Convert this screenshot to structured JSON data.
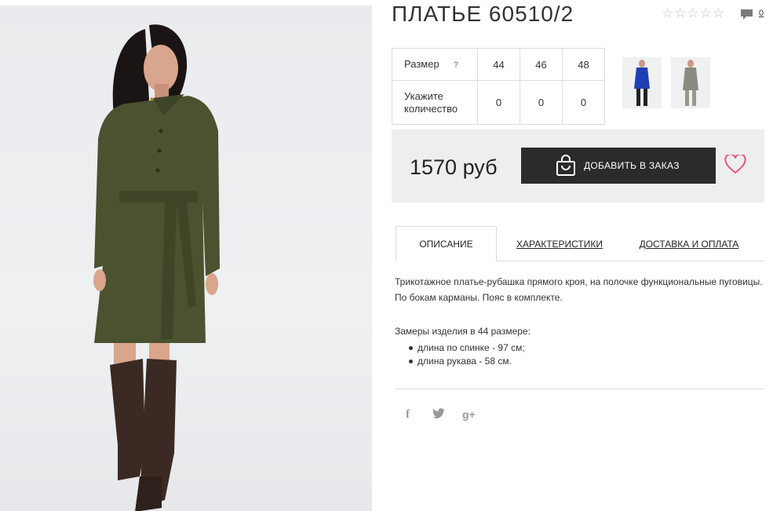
{
  "product": {
    "title": "ПЛАТЬЕ 60510/2",
    "rating_stars": 5,
    "comment_count": "0",
    "star_glyph": "☆"
  },
  "sizes": {
    "size_label": "Размер",
    "help_mark": "?",
    "qty_label": "Укажите количество",
    "columns": [
      "44",
      "46",
      "48"
    ],
    "quantities": [
      "0",
      "0",
      "0"
    ]
  },
  "thumbnails": [
    {
      "name": "blue-dress-thumbnail",
      "color": "#1f3fb5"
    },
    {
      "name": "gray-dress-thumbnail",
      "color": "#8b8a80"
    }
  ],
  "purchase": {
    "price": "1570 руб",
    "add_button_label": "ДОБАВИТЬ В ЗАКАЗ",
    "accent_color": "#e05a7a",
    "button_color": "#2b2b2b"
  },
  "tabs": [
    {
      "label": "ОПИСАНИЕ",
      "active": true
    },
    {
      "label": "ХАРАКТЕРИСТИКИ",
      "active": false
    },
    {
      "label": "ДОСТАВКА И ОПЛАТА",
      "active": false
    }
  ],
  "description": {
    "text": "Трикотажное платье-рубашка прямого кроя, на полочке функциональные пуговицы. По бокам карманы. Пояс в комплекте.",
    "measures_title": "Замеры изделия в 44 размере:",
    "measures": [
      "длина по спинке - 97 см;",
      "длина рукава - 58 см."
    ]
  },
  "social": {
    "facebook": "f",
    "twitter": "twitter-icon",
    "googleplus": "g+"
  }
}
